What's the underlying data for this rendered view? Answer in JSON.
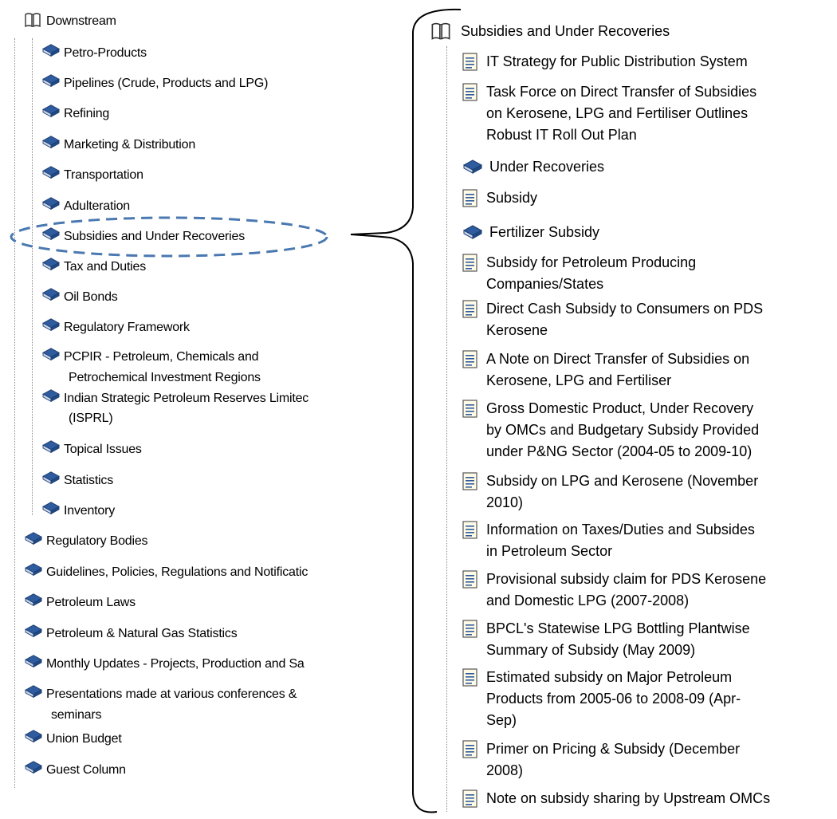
{
  "left_tree": {
    "root": {
      "label": "Downstream",
      "icon": "open-book-icon"
    },
    "children": [
      "Petro-Products",
      "Pipelines (Crude, Products and LPG)",
      "Refining",
      "Marketing & Distribution",
      "Transportation",
      "Adulteration",
      "Subsidies and Under Recoveries",
      "Tax and Duties",
      "Oil Bonds",
      "Regulatory Framework",
      "PCPIR - Petroleum, Chemicals and",
      "Petrochemical Investment Regions",
      "Indian Strategic Petroleum Reserves Limitec",
      "(ISPRL)",
      "Topical Issues",
      "Statistics",
      "Inventory"
    ],
    "siblings": [
      "Regulatory Bodies",
      "Guidelines, Policies, Regulations and Notificatic",
      "Petroleum Laws",
      "Petroleum & Natural Gas Statistics",
      "Monthly Updates - Projects, Production and Sa",
      "Presentations made at various conferences &",
      "seminars",
      "Union Budget",
      "Guest Column"
    ],
    "highlighted": "Subsidies and Under Recoveries"
  },
  "right_tree": {
    "root": {
      "label": "Subsidies and Under Recoveries",
      "icon": "open-book-icon"
    },
    "items": [
      {
        "type": "doc",
        "lines": [
          "IT Strategy for Public Distribution System"
        ]
      },
      {
        "type": "doc",
        "lines": [
          "Task Force on Direct Transfer of Subsidies",
          "on Kerosene, LPG and Fertiliser Outlines",
          "Robust IT Roll Out Plan"
        ]
      },
      {
        "type": "book",
        "lines": [
          "Under Recoveries"
        ]
      },
      {
        "type": "doc",
        "lines": [
          "Subsidy"
        ]
      },
      {
        "type": "book",
        "lines": [
          "Fertilizer Subsidy"
        ]
      },
      {
        "type": "doc",
        "lines": [
          "Subsidy for Petroleum Producing",
          "Companies/States"
        ]
      },
      {
        "type": "doc",
        "lines": [
          "Direct Cash Subsidy to Consumers on PDS",
          "Kerosene"
        ]
      },
      {
        "type": "doc",
        "lines": [
          "A Note on Direct Transfer of Subsidies on",
          "Kerosene, LPG and Fertiliser"
        ]
      },
      {
        "type": "doc",
        "lines": [
          "Gross Domestic Product, Under Recovery",
          "by OMCs and Budgetary Subsidy Provided",
          "under P&NG Sector (2004-05 to 2009-10)"
        ]
      },
      {
        "type": "doc",
        "lines": [
          "Subsidy on LPG and Kerosene (November",
          "2010)"
        ]
      },
      {
        "type": "doc",
        "lines": [
          "Information on Taxes/Duties and Subsides",
          "in Petroleum Sector"
        ]
      },
      {
        "type": "doc",
        "lines": [
          "Provisional subsidy claim for PDS Kerosene",
          "and Domestic LPG (2007-2008)"
        ]
      },
      {
        "type": "doc",
        "lines": [
          "BPCL's Statewise LPG Bottling Plantwise",
          "Summary of Subsidy (May 2009)"
        ]
      },
      {
        "type": "doc",
        "lines": [
          "Estimated subsidy on Major Petroleum",
          "Products from 2005-06 to 2008-09 (Apr-",
          "Sep)"
        ]
      },
      {
        "type": "doc",
        "lines": [
          "Primer on Pricing & Subsidy (December",
          "2008)"
        ]
      },
      {
        "type": "doc",
        "lines": [
          "Note on subsidy sharing by Upstream OMCs"
        ]
      }
    ]
  },
  "colors": {
    "book_blue": "#2f5c9e",
    "highlight_dash": "#4a78b0",
    "doc_icon_border": "#555555"
  }
}
